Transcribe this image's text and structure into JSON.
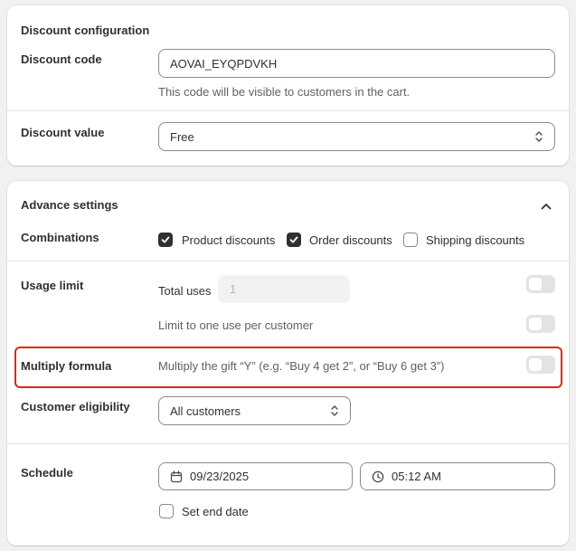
{
  "discount_config": {
    "title": "Discount configuration",
    "code_label": "Discount code",
    "code_value": "AOVAI_EYQPDVKH",
    "code_help": "This code will be visible to customers in the cart.",
    "value_label": "Discount value",
    "value_selected": "Free"
  },
  "advance": {
    "title": "Advance settings",
    "combinations": {
      "label": "Combinations",
      "options": [
        {
          "label": "Product discounts",
          "checked": true
        },
        {
          "label": "Order discounts",
          "checked": true
        },
        {
          "label": "Shipping discounts",
          "checked": false
        }
      ]
    },
    "usage_limit": {
      "label": "Usage limit",
      "total_uses_label": "Total uses",
      "total_uses_placeholder": "1",
      "total_uses_enabled": false,
      "one_per_customer_label": "Limit to one use per customer",
      "one_per_customer_enabled": false
    },
    "multiply": {
      "label": "Multiply formula",
      "description": "Multiply the gift “Y” (e.g. “Buy 4 get 2”, or “Buy 6 get 3”)",
      "enabled": false
    },
    "eligibility": {
      "label": "Customer eligibility",
      "selected": "All customers"
    },
    "schedule": {
      "label": "Schedule",
      "start_date": "09/23/2025",
      "start_time": "05:12 AM",
      "set_end_date_label": "Set end date",
      "set_end_date_checked": false
    }
  },
  "colors": {
    "highlight": "#d72c0d",
    "checkbox_checked": "#303030",
    "toggle_off": "#e3e3e3"
  }
}
